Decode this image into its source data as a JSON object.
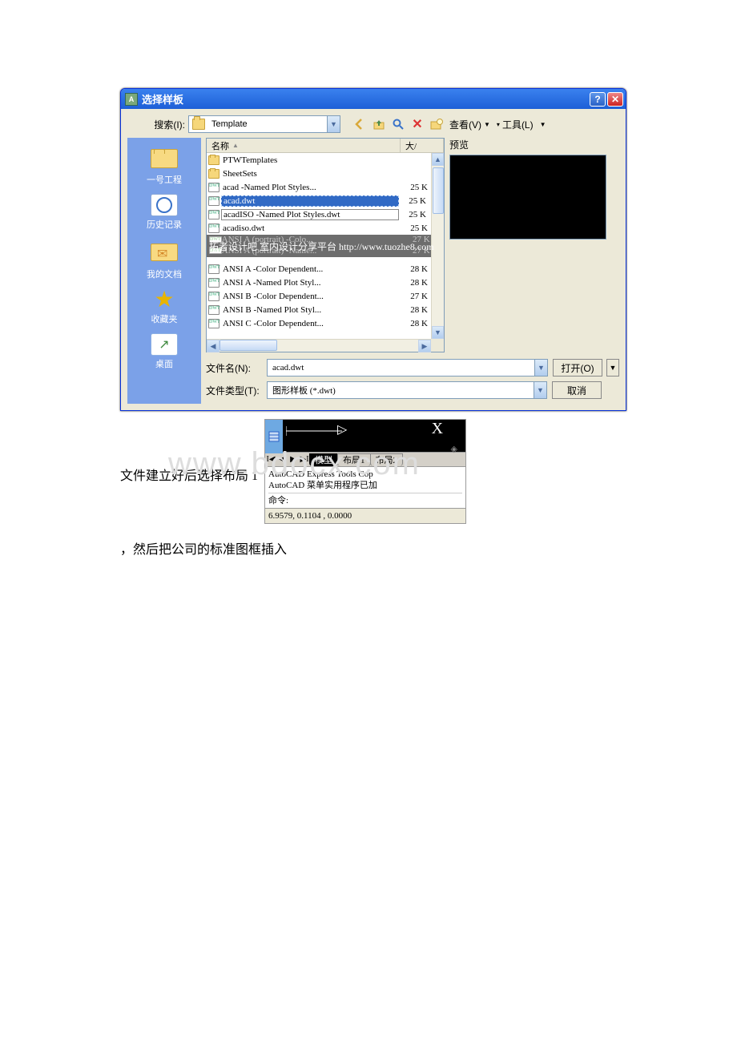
{
  "dialog": {
    "title": "选择样板",
    "search_label": "搜索(I):",
    "look_in": "Template",
    "toolbar": {
      "view_label": "查看(V)",
      "tools_label": "工具(L)"
    },
    "places": [
      {
        "id": "proj1",
        "label": "一号工程"
      },
      {
        "id": "history",
        "label": "历史记录"
      },
      {
        "id": "mydocs",
        "label": "我的文档"
      },
      {
        "id": "favorites",
        "label": "收藏夹"
      },
      {
        "id": "desktop",
        "label": "桌面"
      }
    ],
    "columns": {
      "name": "名称",
      "size": "大/"
    },
    "files": [
      {
        "name": "PTWTemplates",
        "type": "folder",
        "size": ""
      },
      {
        "name": "SheetSets",
        "type": "folder",
        "size": ""
      },
      {
        "name": "acad -Named Plot Styles...",
        "type": "dwt",
        "size": "25 K"
      },
      {
        "name": "acad.dwt",
        "type": "dwt",
        "size": "25 K",
        "selected": true
      },
      {
        "name": "acadISO -Named Plot Styles.dwt",
        "type": "dwt",
        "size": "25 K",
        "boxed": true
      },
      {
        "name": "acadiso.dwt",
        "type": "dwt",
        "size": "25 K"
      },
      {
        "name": "ANSI A (portrait) -Colo...",
        "type": "dwt",
        "size": "27 K",
        "wm": true
      },
      {
        "name": "ANSI A (portrait) -Name...",
        "type": "dwt",
        "size": "27 K",
        "wm": true
      },
      {
        "name": "ANSI A -Color Dependent...",
        "type": "dwt",
        "size": "28 K"
      },
      {
        "name": "ANSI A -Named Plot Styl...",
        "type": "dwt",
        "size": "28 K"
      },
      {
        "name": "ANSI B -Color Dependent...",
        "type": "dwt",
        "size": "27 K"
      },
      {
        "name": "ANSI B -Named Plot Styl...",
        "type": "dwt",
        "size": "28 K"
      },
      {
        "name": "ANSI C -Color Dependent...",
        "type": "dwt",
        "size": "28 K"
      }
    ],
    "preview_label": "预览",
    "filename_label": "文件名(N):",
    "filename_value": "acad.dwt",
    "filetype_label": "文件类型(T):",
    "filetype_value": "图形样板 (*.dwt)",
    "open_label": "打开(O)",
    "cancel_label": "取消",
    "watermark_band": "拓者设计吧  室内设计分享平台 http://www.tuozhe8.com"
  },
  "acad": {
    "tabs": {
      "model": "模型",
      "layout1": "布局1",
      "layout2": "布局2"
    },
    "cmd_line1": "AutoCAD Express Tools Cop",
    "cmd_line2": "AutoCAD 菜单实用程序已加",
    "prompt": "命令:",
    "status": "6.9579,  0.1104 , 0.0000",
    "big_watermark": "www.bdocx.com"
  },
  "doc": {
    "p1": "文件建立好后选择布局 1",
    "p2": "，然后把公司的标准图框插入"
  }
}
